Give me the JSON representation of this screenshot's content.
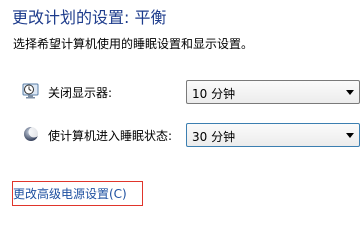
{
  "page": {
    "title": "更改计划的设置: 平衡",
    "description": "选择希望计算机使用的睡眠设置和显示设置。"
  },
  "settings": [
    {
      "label": "关闭显示器:",
      "icon": "clock-monitor-icon",
      "value": "10 分钟"
    },
    {
      "label": "使计算机进入睡眠状态:",
      "icon": "moon-sleep-icon",
      "value": "30 分钟"
    }
  ],
  "links": {
    "advanced_power": "更改高级电源设置(C)"
  },
  "colors": {
    "title": "#1e3c8c",
    "link": "#1e50a0",
    "highlight_box": "#e0352b",
    "focus_border": "#3c7fb1"
  }
}
